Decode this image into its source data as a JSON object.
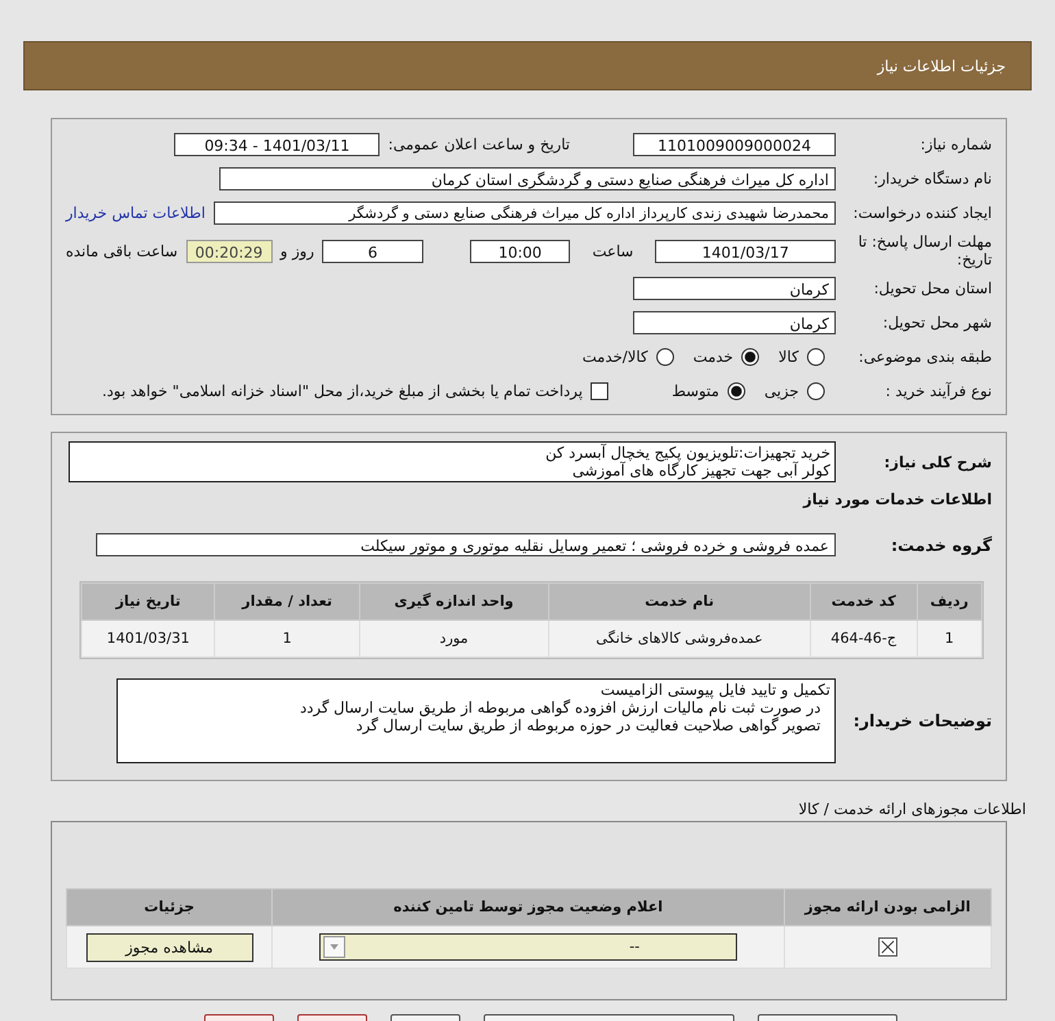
{
  "header": {
    "title": "جزئیات اطلاعات نیاز"
  },
  "need": {
    "number_label": "شماره نیاز:",
    "number": "1101009009000024",
    "announce_label": "تاریخ و ساعت اعلان عمومی:",
    "announce": "1401/03/11 - 09:34",
    "buyer_label": "نام دستگاه خریدار:",
    "buyer": "اداره کل میراث فرهنگی  صنایع دستی و گردشگری استان کرمان",
    "requester_label": "ایجاد کننده درخواست:",
    "requester": "محمدرضا شهیدی زندی کارپرداز اداره کل میراث فرهنگی  صنایع دستی و گردشگر",
    "contact_link": "اطلاعات تماس خریدار",
    "deadline_label": "مهلت ارسال پاسخ: تا تاریخ:",
    "deadline_date": "1401/03/17",
    "time_label": "ساعت",
    "time": "10:00",
    "days": "6",
    "days_label": "روز و",
    "remaining": "00:20:29",
    "remaining_label": "ساعت باقی مانده",
    "province_label": "استان محل تحویل:",
    "province": "کرمان",
    "city_label": "شهر محل تحویل:",
    "city": "کرمان",
    "category_label": "طبقه بندی موضوعی:",
    "category_options": [
      {
        "label": "کالا",
        "selected": false
      },
      {
        "label": "خدمت",
        "selected": true
      },
      {
        "label": "کالا/خدمت",
        "selected": false
      }
    ],
    "process_label": "نوع فرآیند خرید :",
    "process_options": [
      {
        "label": "جزیی",
        "selected": false
      },
      {
        "label": "متوسط",
        "selected": true
      }
    ],
    "payment": {
      "label": "پرداخت تمام یا بخشی از مبلغ خرید،از محل \"اسناد خزانه اسلامی\" خواهد بود.",
      "checked": false
    }
  },
  "details": {
    "summary_label": "شرح کلی نیاز:",
    "summary_lines": [
      "خرید تجهیزات:تلویزیون پکیج یخچال آبسرد کن",
      "کولر آبی  جهت تجهیز کارگاه های آموزشی"
    ],
    "services_title": "اطلاعات خدمات مورد نیاز",
    "group_label": "گروه خدمت:",
    "group_value": "عمده فروشی و خرده فروشی ؛ تعمیر وسایل نقلیه موتوری و موتور سیکلت",
    "table": {
      "columns": [
        "ردیف",
        "کد خدمت",
        "نام خدمت",
        "واحد اندازه گیری",
        "تعداد / مقدار",
        "تاریخ نیاز"
      ],
      "rows": [
        [
          "1",
          "ج-46-464",
          "عمده‌فروشی کالاهای خانگی",
          "مورد",
          "1",
          "1401/03/31"
        ]
      ]
    },
    "notes_label": "توضیحات خریدار:",
    "notes_lines": [
      "تکمیل و تایید فایل پیوستی الزامیست",
      "  در صورت ثبت نام مالیات ارزش افزوده گواهی مربوطه از طریق سایت ارسال گردد",
      "  تصویر گواهی صلاحیت فعالیت در حوزه مربوطه از طریق سایت ارسال گرد"
    ]
  },
  "permits": {
    "title": "اطلاعات مجوزهای ارائه خدمت / کالا",
    "columns": [
      "الزامی بودن ارائه مجوز",
      "اعلام وضعیت مجوز توسط تامین کننده",
      "جزئیات"
    ],
    "rows": [
      {
        "required": true,
        "status": "--",
        "button": "مشاهده مجوز"
      }
    ]
  },
  "bottom_buttons": [
    {
      "kind": "plain"
    },
    {
      "kind": "plain"
    },
    {
      "kind": "plain"
    },
    {
      "kind": "danger"
    },
    {
      "kind": "danger"
    }
  ]
}
